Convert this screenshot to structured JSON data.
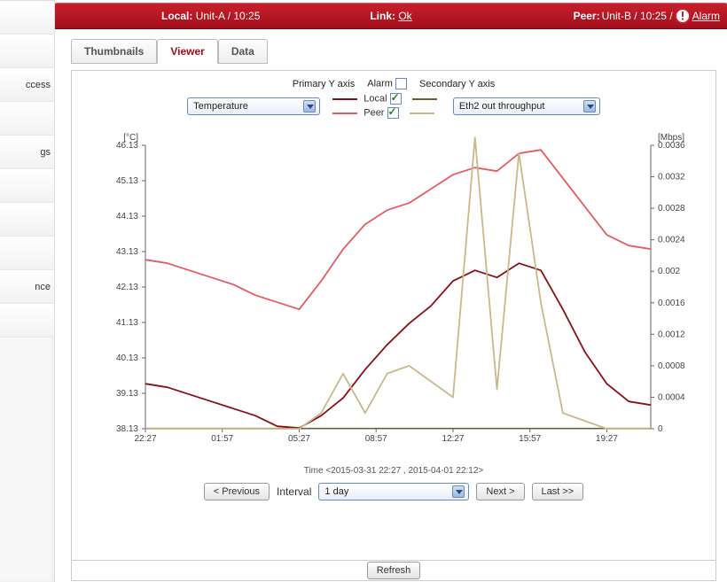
{
  "sidebar": {
    "items": [
      {
        "label": ""
      },
      {
        "label": ""
      },
      {
        "label": "ccess"
      },
      {
        "label": ""
      },
      {
        "label": "gs"
      },
      {
        "label": ""
      },
      {
        "label": ""
      },
      {
        "label": ""
      },
      {
        "label": "nce"
      },
      {
        "label": ""
      }
    ]
  },
  "header": {
    "local_label": "Local:",
    "local_value": "Unit-A / 10:25",
    "link_label": "Link:",
    "link_value": "Ok",
    "peer_label": "Peer:",
    "peer_value": "Unit-B / 10:25 /",
    "alarm_label": "Alarm"
  },
  "tabs": [
    {
      "label": "Thumbnails",
      "active": false
    },
    {
      "label": "Viewer",
      "active": true
    },
    {
      "label": "Data",
      "active": false
    }
  ],
  "controls": {
    "primary_axis_label": "Primary Y axis",
    "secondary_axis_label": "Secondary Y axis",
    "alarm_label": "Alarm",
    "alarm_checked": false,
    "local_label": "Local",
    "local_checked": true,
    "peer_label": "Peer",
    "peer_checked": true,
    "primary_select": "Temperature",
    "secondary_select": "Eth2 out throughput"
  },
  "nav": {
    "prev": "< Previous",
    "interval_label": "Interval",
    "interval_select": "1 day",
    "next": "Next >",
    "last": "Last >>"
  },
  "refresh": {
    "label": "Refresh"
  },
  "chart_data": {
    "type": "line",
    "y1_unit": "[°C]",
    "y2_unit": "[Mbps]",
    "xlabel": "Time  <2015-03-31 22:27 , 2015-04-01 22:12>",
    "x_ticks": [
      "22:27",
      "01:57",
      "05:27",
      "08:57",
      "12:27",
      "15:57",
      "19:27"
    ],
    "y1_ticks": [
      38.13,
      39.13,
      40.13,
      41.13,
      42.13,
      43.13,
      44.13,
      45.13,
      46.13
    ],
    "y2_ticks": [
      0,
      0.0004,
      0.0008,
      0.0012,
      0.0016,
      0.002,
      0.0024,
      0.0028,
      0.0032,
      0.0036
    ],
    "x": [
      "22:27",
      "23:27",
      "00:27",
      "01:27",
      "02:27",
      "03:27",
      "04:27",
      "05:27",
      "06:27",
      "07:27",
      "08:27",
      "09:27",
      "10:27",
      "11:27",
      "12:27",
      "13:27",
      "14:27",
      "15:27",
      "16:27",
      "17:27",
      "18:27",
      "19:27",
      "20:27",
      "21:27"
    ],
    "series": [
      {
        "name": "Local (°C)",
        "color": "#8a0e17",
        "axis": "y1",
        "values": [
          39.4,
          39.3,
          39.1,
          38.9,
          38.7,
          38.5,
          38.2,
          38.15,
          38.5,
          39.0,
          39.8,
          40.5,
          41.1,
          41.6,
          42.3,
          42.6,
          42.4,
          42.8,
          42.6,
          41.5,
          40.3,
          39.4,
          38.9,
          38.8
        ]
      },
      {
        "name": "Peer (°C)",
        "color": "#e75a63",
        "axis": "y1",
        "values": [
          42.9,
          42.8,
          42.6,
          42.4,
          42.2,
          41.9,
          41.7,
          41.5,
          42.3,
          43.2,
          43.9,
          44.3,
          44.5,
          44.9,
          45.3,
          45.5,
          45.4,
          45.9,
          46.0,
          45.2,
          44.4,
          43.6,
          43.3,
          43.2
        ]
      },
      {
        "name": "Eth2 out (Mbps)",
        "color": "#c9b889",
        "axis": "y2",
        "values": [
          0,
          0,
          0,
          0,
          0,
          0,
          0,
          0,
          0.0002,
          0.0007,
          0.0002,
          0.0007,
          0.0008,
          0.0006,
          0.0004,
          0.0037,
          0.0005,
          0.0035,
          0.0016,
          0.0002,
          0.0001,
          0,
          0,
          0
        ]
      }
    ]
  }
}
